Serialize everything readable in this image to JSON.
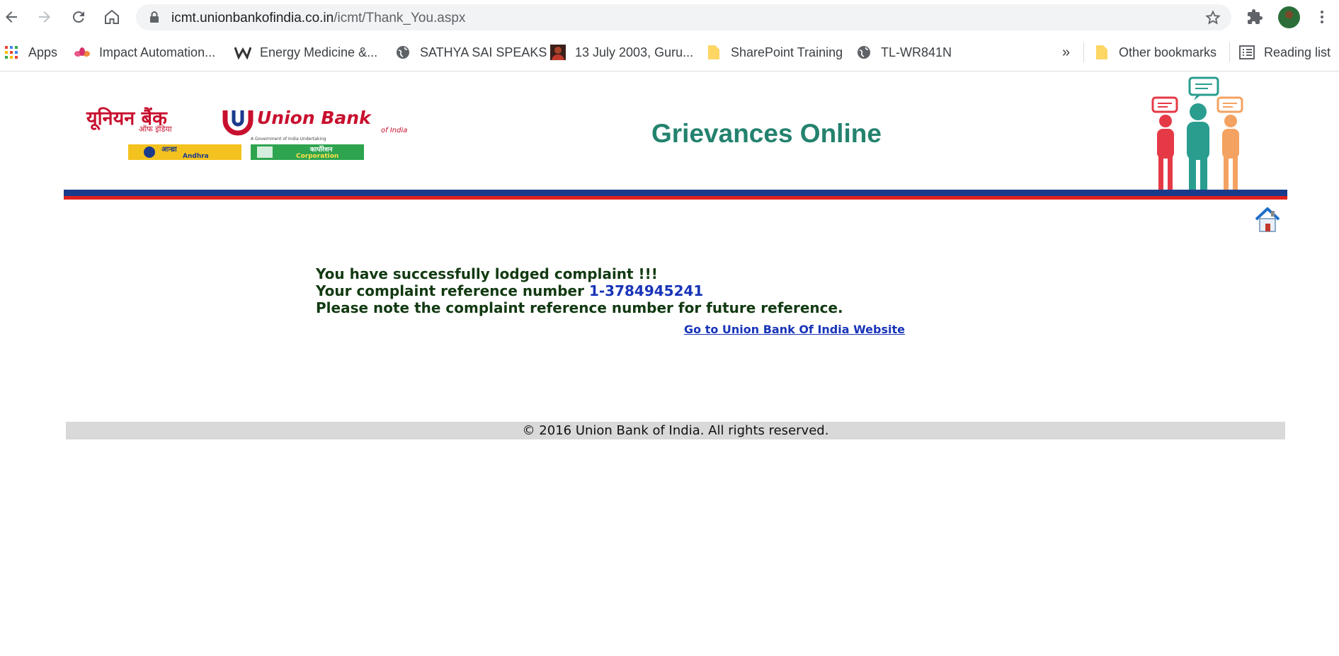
{
  "browser": {
    "url_host": "icmt.unionbankofindia.co.in",
    "url_path": "/icmt/Thank_You.aspx",
    "bookmarks": [
      {
        "label": "Apps",
        "icon": "apps-grid-icon"
      },
      {
        "label": "Impact Automation...",
        "icon": "lotus-icon"
      },
      {
        "label": "Energy Medicine &...",
        "icon": "w-logo-icon"
      },
      {
        "label": "SATHYA SAI SPEAKS",
        "icon": "globe-icon"
      },
      {
        "label": "13 July 2003, Guru...",
        "icon": "person-icon"
      },
      {
        "label": "SharePoint Training",
        "icon": "folder-icon"
      },
      {
        "label": "TL-WR841N",
        "icon": "globe-icon"
      }
    ],
    "overflow_label": "»",
    "other_bookmarks": "Other bookmarks",
    "reading_list": "Reading list"
  },
  "header": {
    "title": "Grievances Online",
    "logo_text_english": "Union Bank",
    "logo_subtext": "of India",
    "logo_text_hindi": "यूनियन बैंक",
    "logo_hindi_sub": "ऑफ इंडिया",
    "logo_tagline": "A Government of India Undertaking",
    "andhra_label": "Andhra",
    "andhra_hindi": "आन्ध्रा",
    "corporation_label": "Corporation",
    "corporation_hindi": "कार्पोरेशन"
  },
  "message": {
    "line1": "You have successfully lodged complaint !!!",
    "line2_prefix": "Your complaint reference number ",
    "reference_number": "1-3784945241",
    "line3": "Please note the complaint reference number for future reference.",
    "link_label": "Go to Union Bank Of India Website"
  },
  "footer": {
    "text": "© 2016 Union Bank of India. All rights reserved."
  },
  "colors": {
    "title_green": "#23826e",
    "stripe_blue": "#1a3a8c",
    "stripe_red": "#e0201c",
    "message_text": "#123a12",
    "link_blue": "#1834b8"
  }
}
